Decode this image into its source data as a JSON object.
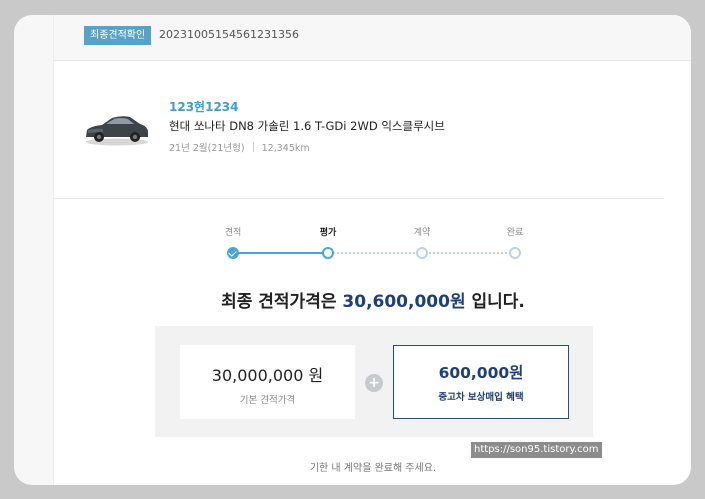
{
  "header": {
    "badge": "최종견적확인",
    "quote_number": "20231005154561231356"
  },
  "car": {
    "plate": "123현1234",
    "model": "현대 쏘나타 DN8 가솔린 1.6 T-GDi 2WD 익스클루시브",
    "year": "21년 2월(21년형)",
    "mileage": "12,345km"
  },
  "steps": [
    {
      "label": "견적",
      "state": "done"
    },
    {
      "label": "평가",
      "state": "current"
    },
    {
      "label": "계약",
      "state": "future"
    },
    {
      "label": "완료",
      "state": "future"
    }
  ],
  "final": {
    "prefix": "최종 견적가격은",
    "amount": "30,600,000원",
    "suffix": "입니다."
  },
  "base": {
    "value": "30,000,000 원",
    "label": "기본 견적가격"
  },
  "bonus": {
    "value": "600,000원",
    "label": "중고차 보상매입 혜택"
  },
  "plus_symbol": "+",
  "deadline": "기한 내 계약을 완료해 주세요.",
  "watermark": "https://son95.tistory.com",
  "colors": {
    "accent": "#4aa5d0",
    "navy": "#1e3f78",
    "badge": "#56a2c8"
  }
}
